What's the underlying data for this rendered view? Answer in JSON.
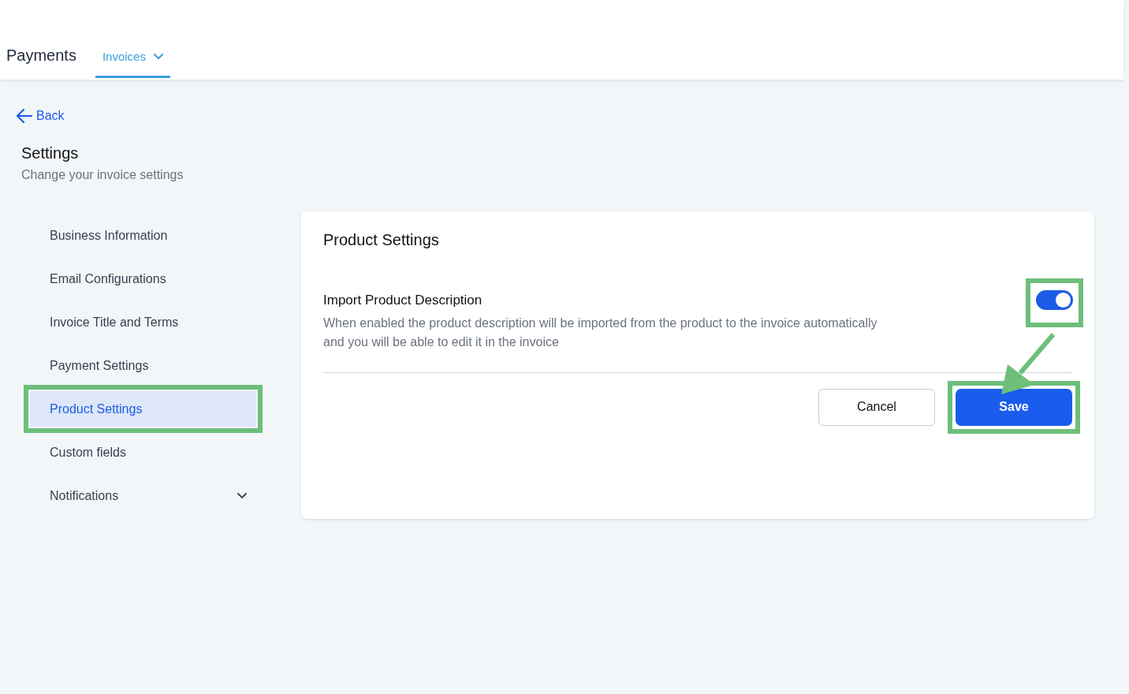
{
  "header": {
    "title": "Payments",
    "tabs": [
      {
        "label": "Invoices",
        "selected": true,
        "has_dropdown": true
      }
    ]
  },
  "back_link": "Back",
  "page": {
    "title": "Settings",
    "subtitle": "Change your invoice settings"
  },
  "sidebar": {
    "items": [
      {
        "label": "Business Information",
        "selected": false,
        "highlighted": false,
        "expandable": false
      },
      {
        "label": "Email Configurations",
        "selected": false,
        "highlighted": false,
        "expandable": false
      },
      {
        "label": "Invoice Title and Terms",
        "selected": false,
        "highlighted": false,
        "expandable": false
      },
      {
        "label": "Payment Settings",
        "selected": false,
        "highlighted": false,
        "expandable": false
      },
      {
        "label": "Product Settings",
        "selected": true,
        "highlighted": true,
        "expandable": false
      },
      {
        "label": "Custom fields",
        "selected": false,
        "highlighted": false,
        "expandable": false
      },
      {
        "label": "Notifications",
        "selected": false,
        "highlighted": false,
        "expandable": true
      }
    ]
  },
  "panel": {
    "title": "Product Settings",
    "settings": [
      {
        "title": "Import Product Description",
        "description": "When enabled the product description will be imported from the product to the invoice automatically and you will be able to edit it in the invoice",
        "on": true,
        "highlighted": true
      }
    ],
    "buttons": [
      {
        "label": "Cancel",
        "kind": "secondary",
        "highlighted": false
      },
      {
        "label": "Save",
        "kind": "primary",
        "highlighted": true
      }
    ]
  },
  "annotation_arrow": true
}
